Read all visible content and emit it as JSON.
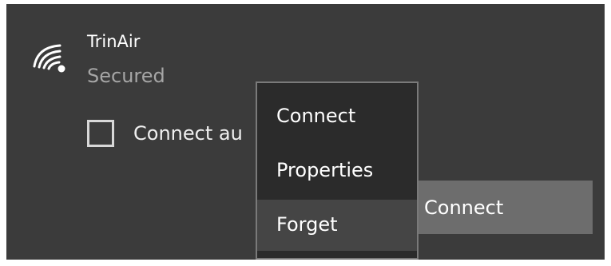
{
  "network": {
    "name": "TrinAir",
    "status": "Secured",
    "auto_connect_label": "Connect au",
    "connect_button_label": "Connect",
    "icon": "wifi-secured-icon"
  },
  "context_menu": {
    "items": [
      {
        "label": "Connect"
      },
      {
        "label": "Properties"
      },
      {
        "label": "Forget",
        "highlighted": true
      }
    ]
  },
  "colors": {
    "panel_background": "#3b3b3b",
    "menu_background": "#2b2b2b",
    "menu_border": "#7a7a7a",
    "button_background": "#6d6d6d",
    "secondary_text": "#a6a6a6"
  }
}
